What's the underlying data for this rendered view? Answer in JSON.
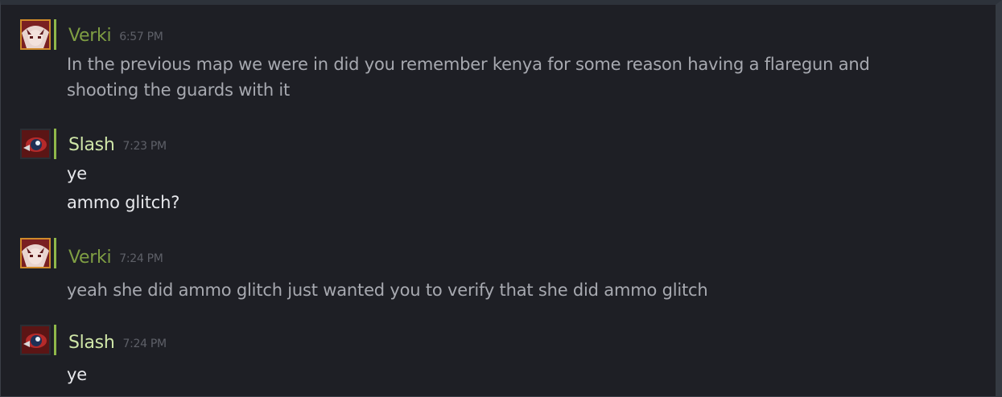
{
  "messages": [
    {
      "author": "Verki",
      "time": "6:57 PM",
      "lines": [
        "In the previous map we were in did you remember kenya for some reason having a flaregun and",
        "shooting the guards with it"
      ]
    },
    {
      "author": "Slash",
      "time": "7:23 PM",
      "lines": [
        "ye",
        "ammo glitch?"
      ]
    },
    {
      "author": "Verki",
      "time": "7:24 PM",
      "lines": [
        "yeah she did ammo glitch just wanted you to verify that she did ammo glitch"
      ]
    },
    {
      "author": "Slash",
      "time": "7:24 PM",
      "lines": [
        "ye"
      ]
    }
  ],
  "colors": {
    "background": "#1e1f25",
    "verki_name": "#7f9e43",
    "slash_name": "#cfe6a8",
    "timestamp": "#5e6068",
    "message_text": "#a7a9b0",
    "message_text_bright": "#e7e8ec",
    "ingame_status": "#8fb84a"
  },
  "icons": {
    "verki_avatar": "anime-girl-avatar-icon",
    "slash_avatar": "masked-figure-avatar-icon"
  }
}
